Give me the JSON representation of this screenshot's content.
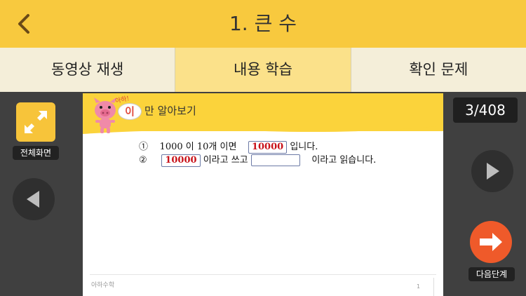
{
  "header": {
    "title": "1. 큰 수",
    "back_icon": "chevron-left-icon"
  },
  "tabs": [
    {
      "label": "동영상 재생",
      "active": false
    },
    {
      "label": "내용 학습",
      "active": true
    },
    {
      "label": "확인 문제",
      "active": false
    }
  ],
  "left_panel": {
    "fullscreen_label": "전체화면",
    "fullscreen_icon": "expand-arrows-icon",
    "prev_icon": "play-left-icon"
  },
  "right_panel": {
    "page_counter": "3/408",
    "next_icon": "play-right-icon",
    "next_step_label": "다음단계",
    "next_step_icon": "arrow-right-icon"
  },
  "document": {
    "header_aha": "아하!",
    "header_bubble": "이",
    "header_text": "만 알아보기",
    "row1": {
      "num": "①",
      "text_before": "1000 이 10개 이면",
      "answer": "10000",
      "text_after": "입니다."
    },
    "row2": {
      "num": "②",
      "answer": "10000",
      "text_middle": "이라고 쓰고",
      "text_after": "이라고 읽습니다."
    },
    "footer_logo": "아하수학",
    "footer_page": "1"
  },
  "colors": {
    "accent": "#f8c93e",
    "tab_active": "#fbe18a",
    "tab_inactive": "#f4eed9",
    "answer_red": "#c8121a",
    "next_step": "#ef5a2a"
  }
}
